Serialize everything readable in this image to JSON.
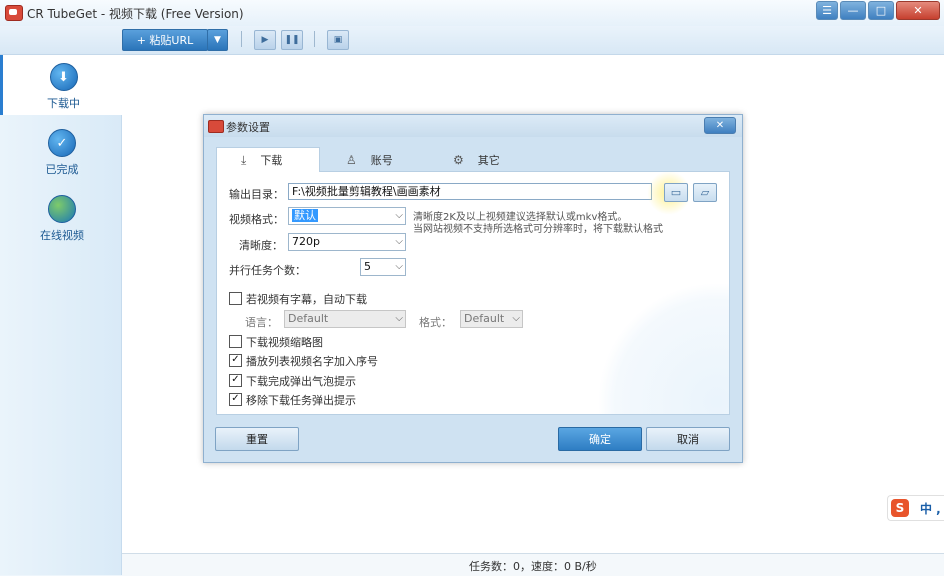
{
  "window": {
    "title": "CR TubeGet - 视频下载 (Free Version)",
    "controls": [
      "☰",
      "—",
      "□",
      "✕"
    ]
  },
  "toolbar": {
    "paste_label": "+ 粘贴URL",
    "dropdown_arrow": "▼"
  },
  "sidebar": {
    "items": [
      {
        "label": "下载中",
        "icon": "download-icon",
        "active": true
      },
      {
        "label": "已完成",
        "icon": "check-icon",
        "active": false
      },
      {
        "label": "在线视频",
        "icon": "globe-icon",
        "active": false
      }
    ]
  },
  "status": {
    "text": "任务数：0，速度：0 B/秒"
  },
  "ime": {
    "logo": "S",
    "text": "中 ,"
  },
  "dialog": {
    "title": "参数设置",
    "close": "✕",
    "tabs": [
      {
        "label": "下载",
        "icon": "download-icon",
        "active": true
      },
      {
        "label": "账号",
        "icon": "user-icon",
        "active": false
      },
      {
        "label": "其它",
        "icon": "gear-icon",
        "active": false
      }
    ],
    "output_dir_label": "输出目录：",
    "output_dir_value": "F:\\视频批量剪辑教程\\画画素材",
    "format_label": "视频格式：",
    "format_value": "默认",
    "quality_label": "清晰度：",
    "quality_value": "720p",
    "hint_line1": "清晰度2K及以上视频建议选择默认或mkv格式。",
    "hint_line2": "当网站视频不支持所选格式可分辨率时，将下载默认格式",
    "parallel_label": "并行任务个数：",
    "parallel_value": "5",
    "subtitle_checkbox": {
      "label": "若视频有字幕，自动下载",
      "checked": false
    },
    "language_label": "语言：",
    "language_value": "Default",
    "sub_format_label": "格式：",
    "sub_format_value": "Default",
    "checkboxes": [
      {
        "label": "下载视频缩略图",
        "checked": false
      },
      {
        "label": "播放列表视频名字加入序号",
        "checked": true
      },
      {
        "label": "下载完成弹出气泡提示",
        "checked": true
      },
      {
        "label": "移除下载任务弹出提示",
        "checked": true
      }
    ],
    "reset_label": "重置",
    "ok_label": "确定",
    "cancel_label": "取消"
  }
}
